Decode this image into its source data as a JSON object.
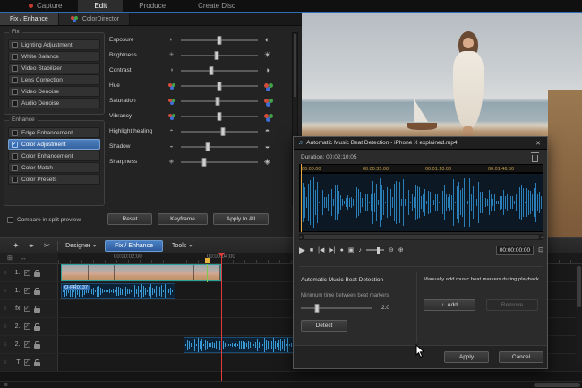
{
  "colors": {
    "accent_blue": "#2f6db8",
    "waveform_blue": "#2b7fb8",
    "playhead_red": "#e23b3b",
    "marker_yellow": "#e8b33c",
    "selected_row_blue": "#35639f"
  },
  "glyphs": {
    "chevron_down": "▾",
    "wand": "✦",
    "split": "◂▸",
    "scissors": "✂",
    "close": "✕",
    "note": "♫",
    "handle": "≡",
    "menu": "≣",
    "snap": "⊞",
    "range": "↔",
    "scroll_left": "◂",
    "scroll_right": "▸",
    "zoom_out": "⊖",
    "zoom_in": "⊕",
    "add_arrow": "↑",
    "detach": "⊡"
  },
  "topbar": {
    "tabs": [
      {
        "label": "Capture"
      },
      {
        "label": "Edit",
        "active": true
      },
      {
        "label": "Produce"
      },
      {
        "label": "Create Disc"
      }
    ]
  },
  "panel": {
    "tabs": [
      {
        "label": "Fix / Enhance",
        "active": true
      },
      {
        "label": "ColorDirector"
      }
    ],
    "fix": {
      "title": "Fix",
      "items": [
        {
          "label": "Lighting Adjustment",
          "checked": false
        },
        {
          "label": "White Balance",
          "checked": false
        },
        {
          "label": "Video Stabilizer",
          "checked": false
        },
        {
          "label": "Lens Correction",
          "checked": false
        },
        {
          "label": "Video Denoise",
          "checked": false
        },
        {
          "label": "Audio Denoise",
          "checked": false
        }
      ]
    },
    "enhance": {
      "title": "Enhance",
      "items": [
        {
          "label": "Edge Enhancement",
          "checked": false
        },
        {
          "label": "Color Adjustment",
          "checked": true,
          "selected": true
        },
        {
          "label": "Color Enhancement",
          "checked": false
        },
        {
          "label": "Color Match",
          "checked": false
        },
        {
          "label": "Color Presets",
          "checked": false
        }
      ]
    },
    "sliders": [
      {
        "label": "Exposure",
        "icon": "exposure",
        "value": 50
      },
      {
        "label": "Brightness",
        "icon": "brightness",
        "value": 47
      },
      {
        "label": "Contrast",
        "icon": "contrast",
        "value": 40
      },
      {
        "label": "Hue",
        "icon": "rgb",
        "value": 50
      },
      {
        "label": "Saturation",
        "icon": "rgb",
        "value": 48
      },
      {
        "label": "Vibrancy",
        "icon": "rgb",
        "value": 50
      },
      {
        "label": "Highlight healing",
        "icon": "highlight",
        "value": 55
      },
      {
        "label": "Shadow",
        "icon": "shadow",
        "value": 35
      },
      {
        "label": "Sharpness",
        "icon": "sharpness",
        "value": 30
      }
    ],
    "compare_label": "Compare in split preview",
    "compare_checked": false,
    "buttons": {
      "reset": "Reset",
      "keyframe": "Keyframe",
      "apply_all": "Apply to All"
    }
  },
  "toolbar": {
    "designer": "Designer",
    "fix_enhance": "Fix / Enhance",
    "tools": "Tools"
  },
  "dialog": {
    "title": "Automatic Music Beat Detection - iPhone X explained.mp4",
    "duration": "Duration: 00:02:10:05",
    "ruler": [
      "00:00:00",
      "00:00:35:00",
      "00:01:10:00",
      "00:01:46:00"
    ],
    "transport": [
      {
        "name": "play",
        "glyph": "▶"
      },
      {
        "name": "stop",
        "glyph": "■"
      },
      {
        "name": "previous-frame",
        "glyph": "|◀"
      },
      {
        "name": "next-frame",
        "glyph": "▶|"
      },
      {
        "name": "record",
        "glyph": "●"
      },
      {
        "name": "snapshot",
        "glyph": "▣"
      },
      {
        "name": "mute",
        "glyph": "♪"
      }
    ],
    "timecode": "00:00:00:00",
    "auto_section": {
      "title": "Automatic Music Beat Detection",
      "min_label": "Minimum time between beat markers",
      "min_value": "2.0",
      "min_slider_pos": 22,
      "detect": "Detect"
    },
    "manual_section": {
      "title": "Manually add music beat markers during playback",
      "add": "Add",
      "remove": "Remove"
    },
    "apply": "Apply",
    "cancel": "Cancel"
  },
  "timeline": {
    "ruler_labels": [
      {
        "text": "00:00:02:00"
      },
      {
        "text": "00:00:04:00"
      }
    ],
    "tracks": [
      {
        "num": "1."
      },
      {
        "num": "1."
      },
      {
        "num": "fx"
      },
      {
        "num": "2."
      },
      {
        "num": "2."
      },
      {
        "num": "T"
      }
    ],
    "clip_label": "O-PR0137"
  }
}
